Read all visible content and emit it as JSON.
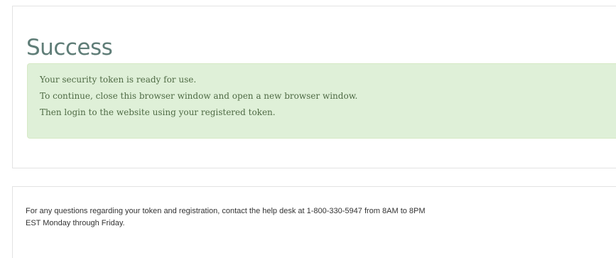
{
  "success": {
    "title": "Success",
    "messages": [
      "Your security token is ready for use.",
      "To continue, close this browser window and open a new browser window.",
      "Then login to the website using your registered token."
    ]
  },
  "help": {
    "line1": "For any questions regarding your token and registration, contact the help desk at 1-800-330-5947 from 8AM to 8PM",
    "line2": "EST Monday through Friday."
  },
  "colors": {
    "title": "#5f7d77",
    "alert_background": "#dff0d8",
    "alert_border": "#d6e9c6",
    "alert_text": "#4f6b45"
  }
}
